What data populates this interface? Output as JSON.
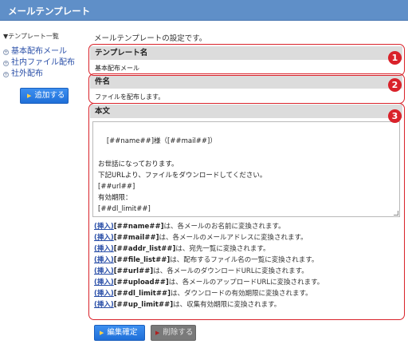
{
  "window": {
    "title": "メールテンプレート"
  },
  "sidebar": {
    "header": "▼テンプレート一覧",
    "items": [
      {
        "label": "基本配布メール"
      },
      {
        "label": "社内ファイル配布"
      },
      {
        "label": "社外配布"
      }
    ],
    "add_button": "追加する"
  },
  "main": {
    "description": "メールテンプレートの設定です。",
    "template_name": {
      "header": "テンプレート名",
      "value": "基本配布メール"
    },
    "subject": {
      "header": "件名",
      "value": "ファイルを配布します。"
    },
    "body": {
      "header": "本文",
      "value": "[##name##]様（[##mail##]）\n\nお世話になっております。\n下記URLより、ファイルをダウンロードしてください。\n[##url##]\n有効期限：\n[##dl_limit##]\n\nよろしくお願いいたします。"
    },
    "hints": [
      {
        "insert": "(挿入)",
        "tag": "[##name##]",
        "text": "は、各メールのお名前に変換されます。"
      },
      {
        "insert": "(挿入)",
        "tag": "[##mail##]",
        "text": "は、各メールのメールアドレスに変換されます。"
      },
      {
        "insert": "(挿入)",
        "tag": "[##addr_list##]",
        "text": "は、宛先一覧に変換されます。"
      },
      {
        "insert": "(挿入)",
        "tag": "[##file_list##]",
        "text": "は、配布するファイル名の一覧に変換されます。"
      },
      {
        "insert": "(挿入)",
        "tag": "[##url##]",
        "text": "は、各メールのダウンロードURLに変換されます。"
      },
      {
        "insert": "(挿入)",
        "tag": "[##upload##]",
        "text": "は、各メールのアップロードURLに変換されます。"
      },
      {
        "insert": "(挿入)",
        "tag": "[##dl_limit##]",
        "text": "は、ダウンロードの有効期限に変換されます。"
      },
      {
        "insert": "(挿入)",
        "tag": "[##up_limit##]",
        "text": "は、収集有効期限に変換されます。"
      }
    ],
    "confirm_button": "編集確定",
    "delete_button": "削除する"
  },
  "annotations": [
    "1",
    "2",
    "3"
  ],
  "colors": {
    "highlight": "#d9222a",
    "titlebar": "#5f8fc8",
    "primary_button": "#1f6fd8"
  }
}
